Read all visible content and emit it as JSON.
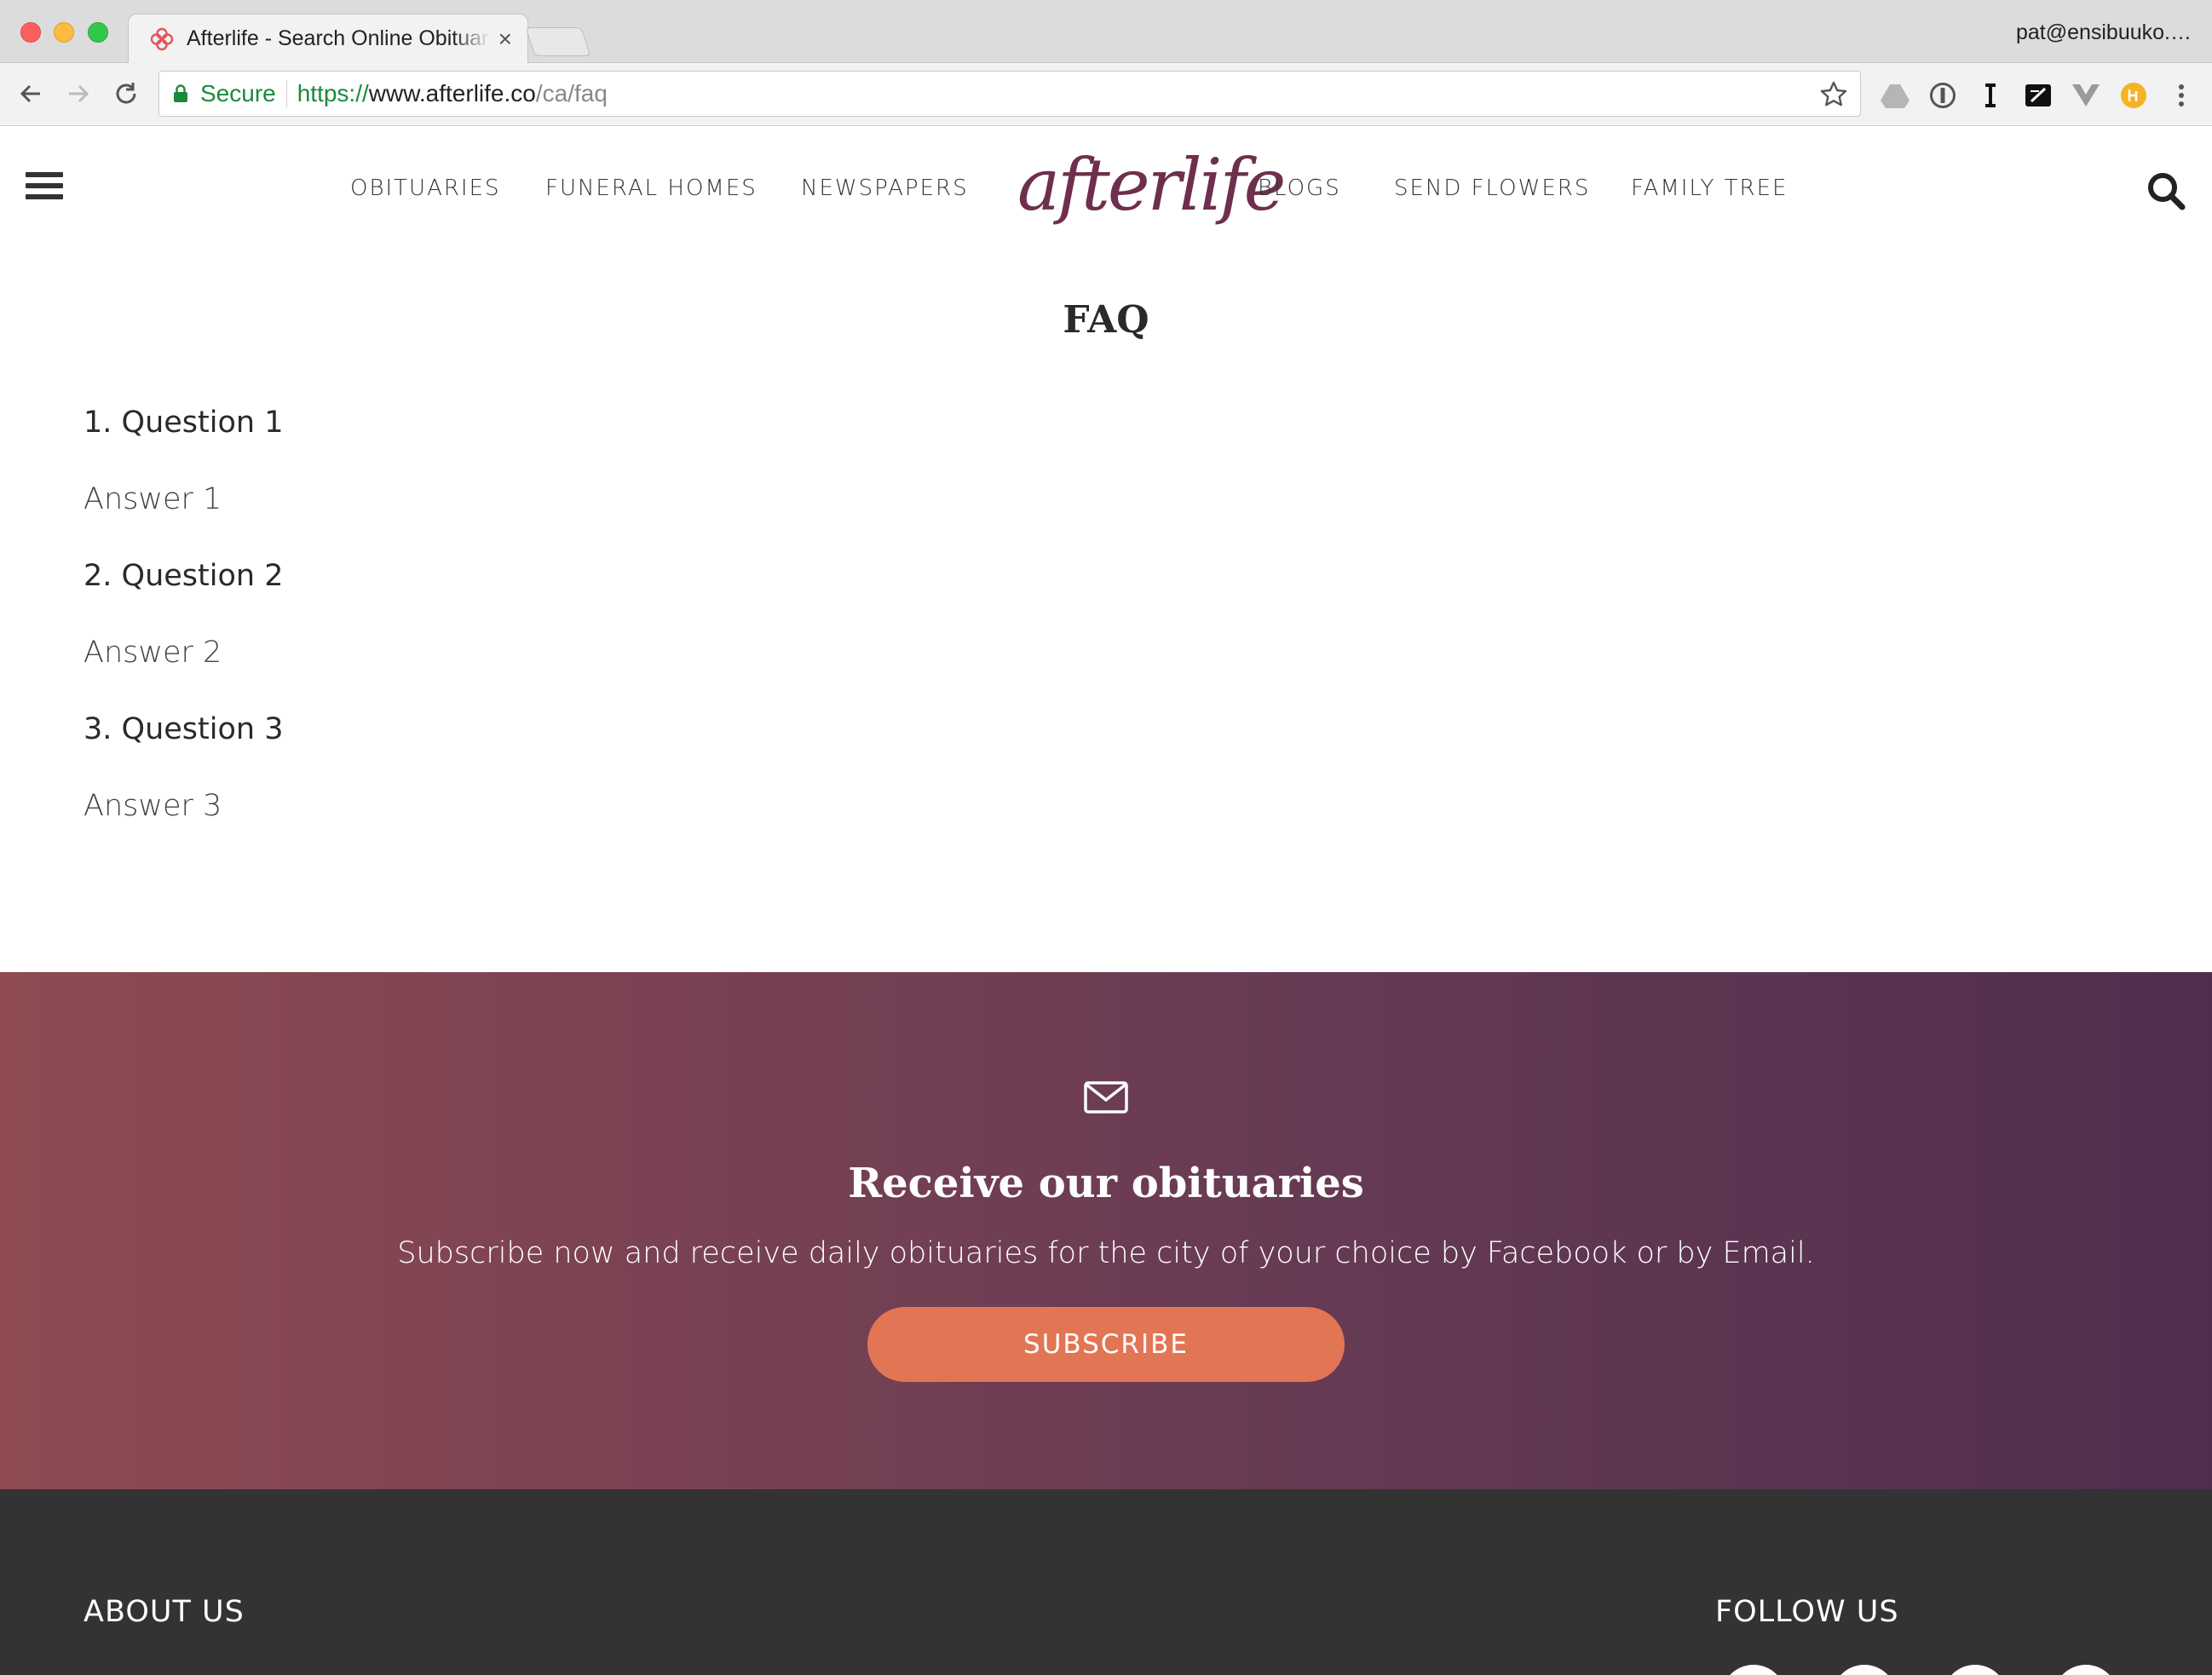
{
  "browser": {
    "tab_title": "Afterlife - Search Online Obituaries",
    "user": "pat@ensibuuko.…",
    "secure_label": "Secure",
    "url_scheme": "https://",
    "url_host": "www.afterlife.co",
    "url_path": "/ca/faq"
  },
  "site": {
    "logo_text": "afterlife",
    "brand_color": "#6e2f4d",
    "nav_left": [
      "OBITUARIES",
      "FUNERAL HOMES",
      "NEWSPAPERS"
    ],
    "nav_right": [
      "BLOGS",
      "SEND FLOWERS",
      "FAMILY TREE"
    ]
  },
  "faq": {
    "title": "FAQ",
    "items": [
      {
        "question": "1. Question 1",
        "answer": "Answer 1"
      },
      {
        "question": "2. Question 2",
        "answer": "Answer 2"
      },
      {
        "question": "3. Question 3",
        "answer": "Answer 3"
      }
    ]
  },
  "subscribe": {
    "icon": "envelope-icon",
    "title": "Receive our obituaries",
    "text": "Subscribe now and receive daily obituaries for the city of your choice by Facebook or by Email.",
    "button_label": "SUBSCRIBE",
    "button_color": "#e27554"
  },
  "footer": {
    "about_heading": "ABOUT US",
    "follow_heading": "FOLLOW US"
  }
}
